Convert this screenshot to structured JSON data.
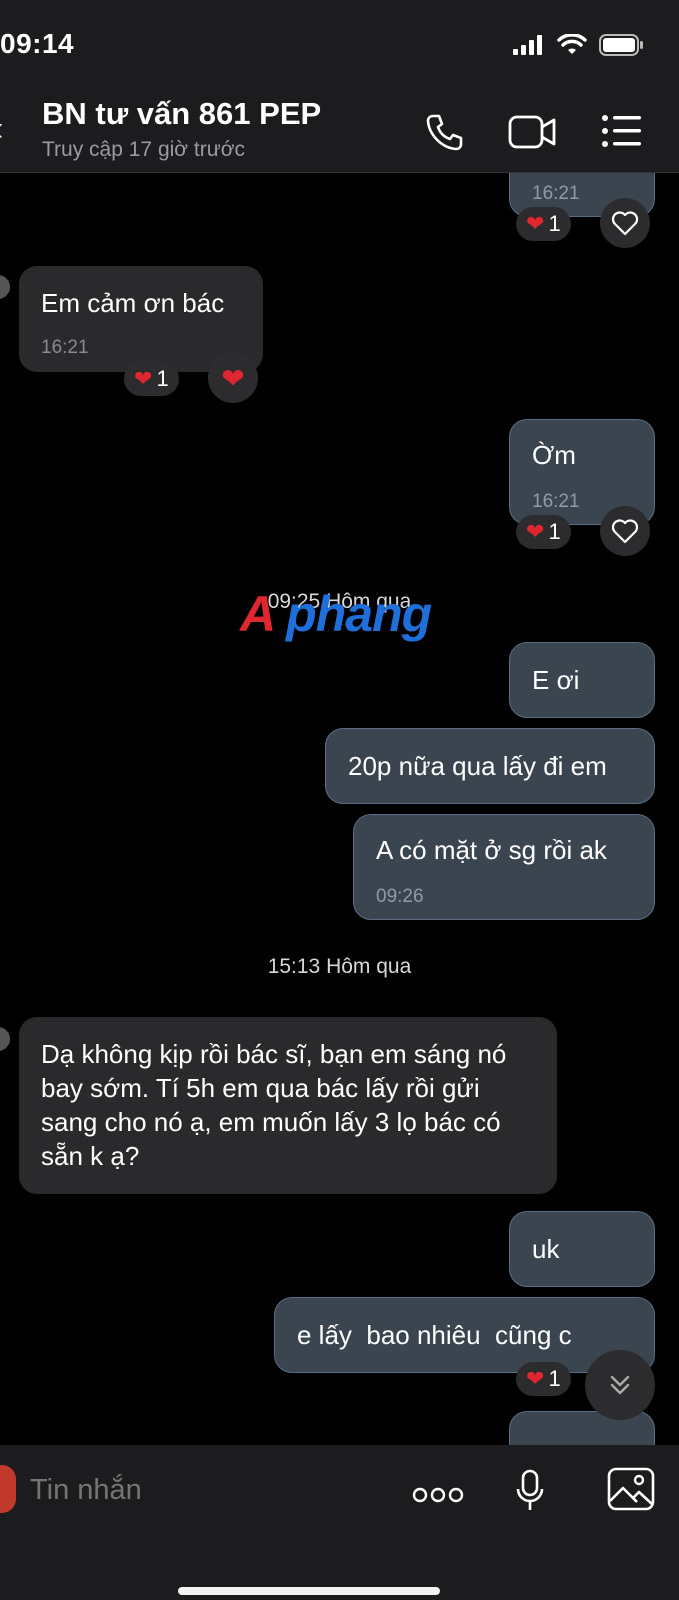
{
  "status_bar": {
    "time": "09:14"
  },
  "header": {
    "title": "BN tư vấn 861 PEP",
    "subtitle": "Truy cập 17 giờ trước"
  },
  "messages": [
    {
      "dir": "out",
      "text": "",
      "time": "16:21",
      "reaction_count": "1"
    },
    {
      "dir": "in",
      "text": "Em cảm ơn bác",
      "time": "16:21",
      "reaction_count": "1"
    },
    {
      "dir": "out",
      "text": "Ờm",
      "time": "16:21",
      "reaction_count": "1"
    },
    {
      "dir": "out",
      "text": "E ơi"
    },
    {
      "dir": "out",
      "text": "20p nữa qua lấy đi em"
    },
    {
      "dir": "out",
      "text": "A có mặt ở sg rồi ak",
      "time": "09:26"
    },
    {
      "dir": "in",
      "text": "Dạ không kịp rồi bác sĩ, bạn em  sáng nó bay sớm. Tí 5h em qua bác lấy rồi gửi sang cho nó ạ, em muốn lấy 3 lọ bác có sẵn k ạ?"
    },
    {
      "dir": "out",
      "text": "uk"
    },
    {
      "dir": "out",
      "text": "e lấy  bao nhiêu  cũng c",
      "reaction_count": "1"
    }
  ],
  "date_separators": [
    "09:25 Hôm qua",
    "15:13 Hôm qua"
  ],
  "watermark": "Aphang",
  "composer": {
    "placeholder": "Tin nhắn"
  },
  "colors": {
    "outgoing_bubble": "#3b4550",
    "incoming_bubble": "#2a2a2c",
    "heart": "#e0262e",
    "background": "#000000"
  }
}
